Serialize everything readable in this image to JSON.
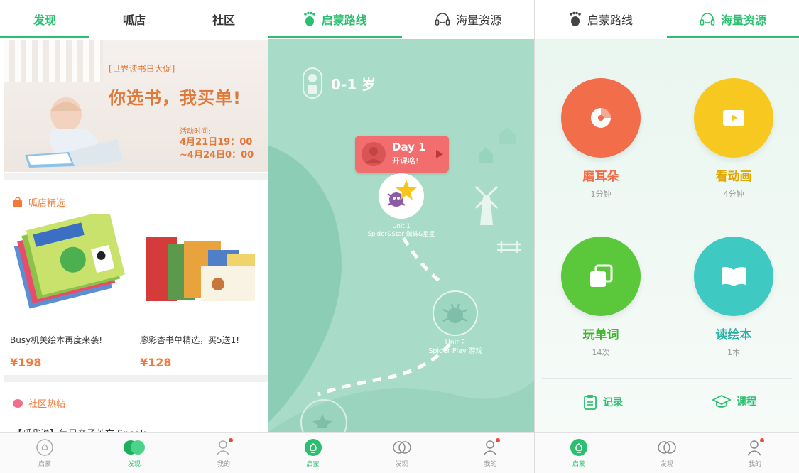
{
  "screen1": {
    "tabs": [
      "发现",
      "呱店",
      "社区"
    ],
    "banner": {
      "subtitle": "[世界读书日大促]",
      "headline": "你选书，我买单!",
      "event_label": "活动时间:",
      "event_time": "4月21日19：00 ~4月24日0：00"
    },
    "shop_section": "呱店精选",
    "products": [
      {
        "name": "Busy机关绘本再度来袭!",
        "price": "¥198"
      },
      {
        "name": "廖彩杏书单精选，买5送1!",
        "price": "¥128"
      }
    ],
    "community_section": "社区热帖",
    "community_post_preview": "【呱我说】每日亲子英文 Speak",
    "nav": [
      "启蒙",
      "发现",
      "我的"
    ]
  },
  "screen2": {
    "tabs": [
      "启蒙路线",
      "海量资源"
    ],
    "age": "0-1 岁",
    "bubble": {
      "day": "Day 1",
      "sub": "开课咯!"
    },
    "unit1": {
      "line1": "Unit 1",
      "line2": "Spider&Star 蜘蛛&星星"
    },
    "unit2": {
      "line1": "Unit 2",
      "line2": "Spider Play 游戏"
    },
    "nav": [
      "启蒙",
      "发现",
      "我的"
    ]
  },
  "screen3": {
    "tabs": [
      "启蒙路线",
      "海量资源"
    ],
    "features": [
      {
        "title": "磨耳朵",
        "count": "1分钟",
        "color": "#f26d4a",
        "text_color": "#f26d4a"
      },
      {
        "title": "看动画",
        "count": "4分钟",
        "color": "#f6c820",
        "text_color": "#e0a800"
      },
      {
        "title": "玩单词",
        "count": "14次",
        "color": "#5bc73a",
        "text_color": "#3fb52a"
      },
      {
        "title": "读绘本",
        "count": "1本",
        "color": "#3ec9c2",
        "text_color": "#2bb0a8"
      }
    ],
    "links": [
      "记录",
      "课程"
    ],
    "nav": [
      "启蒙",
      "发现",
      "我的"
    ]
  },
  "colors": {
    "accent": "#2bbf6f",
    "orange": "#f2793a",
    "notify": "#f0443c"
  }
}
